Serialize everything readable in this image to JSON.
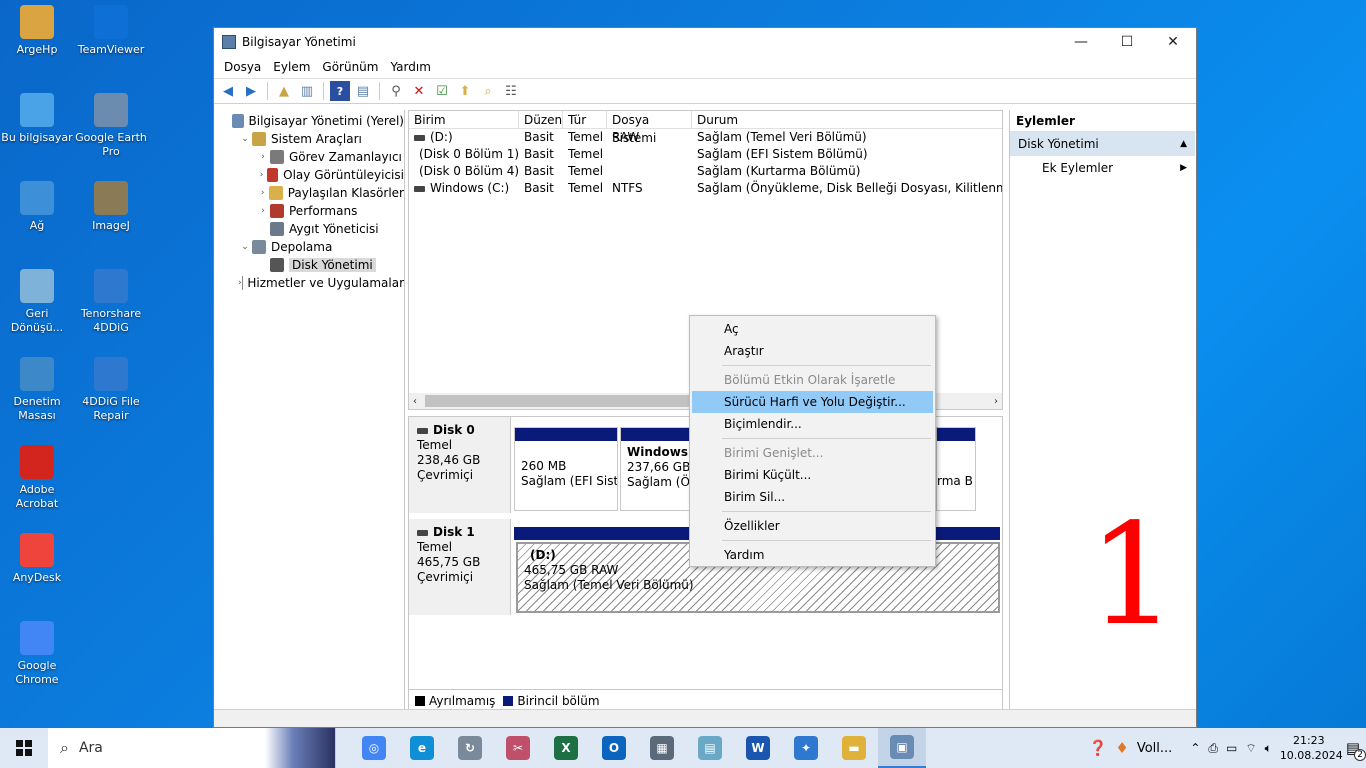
{
  "desktop_icons": [
    {
      "label": "ArgeHp",
      "icon": "user-folder-icon",
      "color": "#d9a441"
    },
    {
      "label": "TeamViewer",
      "icon": "teamviewer-icon",
      "color": "#0e6fd6"
    },
    {
      "label": "Bu bilgisayar",
      "icon": "computer-icon",
      "color": "#4aa3e6"
    },
    {
      "label": "Google Earth Pro",
      "icon": "google-earth-icon",
      "color": "#6b8cae"
    },
    {
      "label": "Ağ",
      "icon": "network-icon",
      "color": "#3d8fd8"
    },
    {
      "label": "ImageJ",
      "icon": "imagej-icon",
      "color": "#8a7a55"
    },
    {
      "label": "Geri Dönüşü...",
      "icon": "recycle-bin-icon",
      "color": "#7fb2d8"
    },
    {
      "label": "Tenorshare 4DDiG",
      "icon": "tenorshare-icon",
      "color": "#2f78d0"
    },
    {
      "label": "Denetim Masası",
      "icon": "control-panel-icon",
      "color": "#3c88c8"
    },
    {
      "label": "4DDiG File Repair",
      "icon": "4ddig-repair-icon",
      "color": "#2f78d0"
    },
    {
      "label": "Adobe Acrobat",
      "icon": "acrobat-icon",
      "color": "#d3251d"
    },
    {
      "label": "AnyDesk",
      "icon": "anydesk-icon",
      "color": "#ef443b"
    },
    {
      "label": "Google Chrome",
      "icon": "chrome-icon",
      "color": "#4285f4"
    }
  ],
  "window": {
    "title": "Bilgisayar Yönetimi",
    "menu": [
      "Dosya",
      "Eylem",
      "Görünüm",
      "Yardım"
    ]
  },
  "tree": [
    {
      "label": "Bilgisayar Yönetimi (Yerel)",
      "level": 0,
      "exp": "",
      "icon": "computer-management-icon",
      "color": "#6a8cb4"
    },
    {
      "label": "Sistem Araçları",
      "level": 1,
      "exp": "⌄",
      "icon": "tools-icon",
      "color": "#c9a445"
    },
    {
      "label": "Görev Zamanlayıcı",
      "level": 2,
      "exp": "›",
      "icon": "clock-icon",
      "color": "#7a7a7a"
    },
    {
      "label": "Olay Görüntüleyicisi",
      "level": 2,
      "exp": "›",
      "icon": "event-viewer-icon",
      "color": "#c0392b"
    },
    {
      "label": "Paylaşılan Klasörler",
      "level": 2,
      "exp": "›",
      "icon": "shared-folder-icon",
      "color": "#d9b04a"
    },
    {
      "label": "Performans",
      "level": 2,
      "exp": "›",
      "icon": "performance-icon",
      "color": "#b03a2e"
    },
    {
      "label": "Aygıt Yöneticisi",
      "level": 2,
      "exp": "",
      "icon": "device-manager-icon",
      "color": "#6b7a8a"
    },
    {
      "label": "Depolama",
      "level": 1,
      "exp": "⌄",
      "icon": "storage-icon",
      "color": "#7a8a9a"
    },
    {
      "label": "Disk Yönetimi",
      "level": 2,
      "exp": "",
      "icon": "disk-icon",
      "color": "#555555",
      "selected": true
    },
    {
      "label": "Hizmetler ve Uygulamalar",
      "level": 1,
      "exp": "›",
      "icon": "services-icon",
      "color": "#8a8a8a"
    }
  ],
  "volume_list": {
    "headers": [
      "Birim",
      "Düzen",
      "Tür",
      "Dosya Sistemi",
      "Durum"
    ],
    "rows": [
      [
        "(D:)",
        "Basit",
        "Temel",
        "RAW",
        "Sağlam (Temel Veri Bölümü)"
      ],
      [
        "(Disk 0 Bölüm 1)",
        "Basit",
        "Temel",
        "",
        "Sağlam (EFI Sistem Bölümü)"
      ],
      [
        "(Disk 0 Bölüm 4)",
        "Basit",
        "Temel",
        "",
        "Sağlam (Kurtarma Bölümü)"
      ],
      [
        "Windows (C:)",
        "Basit",
        "Temel",
        "NTFS",
        "Sağlam (Önyükleme, Disk Belleği Dosyası, Kilitlenme Bilgis"
      ]
    ]
  },
  "disks": {
    "disk0": {
      "name": "Disk 0",
      "type": "Temel",
      "size": "238,46 GB",
      "status": "Çevrimiçi"
    },
    "disk1": {
      "name": "Disk 1",
      "type": "Temel",
      "size": "465,75 GB",
      "status": "Çevrimiçi"
    },
    "d0_part1": {
      "size": "260 MB",
      "status": "Sağlam (EFI Sistem"
    },
    "d0_part2": {
      "name": "Windows  (",
      "size": "237,66 GB N",
      "status": "Sağlam (Ön"
    },
    "d0_part3": {
      "status": "rma B"
    },
    "d1_part1": {
      "name": "(D:)",
      "size": "465,75 GB RAW",
      "status": "Sağlam (Temel Veri Bölümü)"
    }
  },
  "legend": [
    {
      "label": "Ayrılmamış",
      "color": "#000000"
    },
    {
      "label": "Birincil bölüm",
      "color": "#0a1a7a"
    }
  ],
  "actions": {
    "header": "Eylemler",
    "selected": "Disk Yönetimi",
    "item": "Ek Eylemler"
  },
  "context_menu": [
    {
      "label": "Aç",
      "state": "normal"
    },
    {
      "label": "Araştır",
      "state": "normal"
    },
    {
      "sep": true
    },
    {
      "label": "Bölümü Etkin Olarak İşaretle",
      "state": "disabled"
    },
    {
      "label": "Sürücü Harfi ve Yolu Değiştir...",
      "state": "highlighted"
    },
    {
      "label": "Biçimlendir...",
      "state": "normal"
    },
    {
      "sep": true
    },
    {
      "label": "Birimi Genişlet...",
      "state": "disabled"
    },
    {
      "label": "Birimi Küçült...",
      "state": "normal"
    },
    {
      "label": "Birim Sil...",
      "state": "normal"
    },
    {
      "sep": true
    },
    {
      "label": "Özellikler",
      "state": "normal"
    },
    {
      "sep": true
    },
    {
      "label": "Yardım",
      "state": "normal"
    }
  ],
  "annotation": "1",
  "taskbar": {
    "search_placeholder": "Ara",
    "apps": [
      {
        "icon": "chrome-icon",
        "color": "#4285f4",
        "glyph": "◎"
      },
      {
        "icon": "edge-icon",
        "color": "#0f8fd6",
        "glyph": "e"
      },
      {
        "icon": "recovery-tool-icon",
        "color": "#7a8a9a",
        "glyph": "↻"
      },
      {
        "icon": "snipping-icon",
        "color": "#c0506a",
        "glyph": "✂"
      },
      {
        "icon": "excel-icon",
        "color": "#1d7044",
        "glyph": "X"
      },
      {
        "icon": "outlook-icon",
        "color": "#0a64c0",
        "glyph": "O"
      },
      {
        "icon": "calculator-icon",
        "color": "#5a6a7a",
        "glyph": "▦"
      },
      {
        "icon": "notes-icon",
        "color": "#6aa8c8",
        "glyph": "▤"
      },
      {
        "icon": "word-icon",
        "color": "#1a56b0",
        "glyph": "W"
      },
      {
        "icon": "tenorshare-icon",
        "color": "#2f78d0",
        "glyph": "✦"
      },
      {
        "icon": "file-explorer-icon",
        "color": "#e0b23a",
        "glyph": "▬"
      },
      {
        "icon": "computer-management-icon",
        "color": "#6a8cb4",
        "glyph": "▣",
        "active": true
      }
    ],
    "tray_app_label": "Voll...",
    "time": "21:23",
    "date": "10.08.2024",
    "notification_count": "2"
  }
}
